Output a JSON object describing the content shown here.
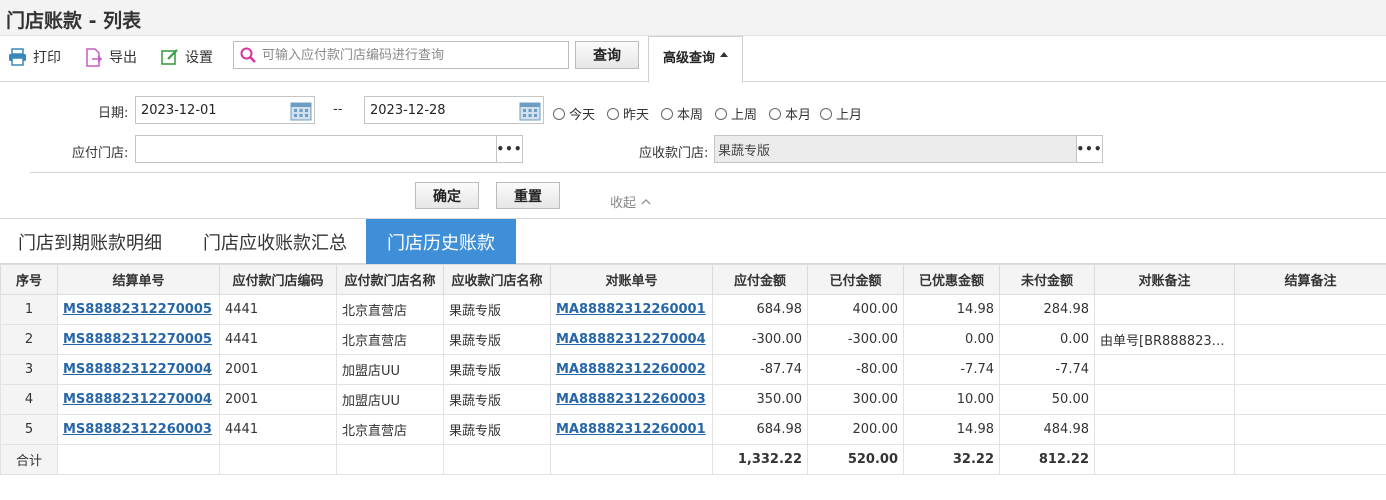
{
  "page": {
    "title": "门店账款 - 列表"
  },
  "toolbar": {
    "print_label": "打印",
    "export_label": "导出",
    "settings_label": "设置",
    "search_placeholder": "可输入应付款门店编码进行查询",
    "search_value": "",
    "query_label": "查询",
    "advanced_label": "高级查询"
  },
  "filter": {
    "date_label": "日期:",
    "date_from": "2023-12-01",
    "date_sep": "--",
    "date_to": "2023-12-28",
    "quick_ranges": [
      "今天",
      "昨天",
      "本周",
      "上周",
      "本月",
      "上月"
    ],
    "payer_label": "应付门店:",
    "payer_value": "",
    "payee_label": "应收款门店:",
    "payee_value": "果蔬专版",
    "confirm_label": "确定",
    "reset_label": "重置",
    "collapse_label": "收起"
  },
  "tabs": [
    {
      "label": "门店到期账款明细",
      "active": false
    },
    {
      "label": "门店应收账款汇总",
      "active": false
    },
    {
      "label": "门店历史账款",
      "active": true
    }
  ],
  "table": {
    "headers": [
      "序号",
      "结算单号",
      "应付款门店编码",
      "应付款门店名称",
      "应收款门店名称",
      "对账单号",
      "应付金额",
      "已付金额",
      "已优惠金额",
      "未付金额",
      "对账备注",
      "结算备注"
    ],
    "rows": [
      [
        "1",
        "MS88882312270005",
        "4441",
        "北京直营店",
        "果蔬专版",
        "MA88882312260001",
        "684.98",
        "400.00",
        "14.98",
        "284.98",
        "",
        ""
      ],
      [
        "2",
        "MS88882312270005",
        "4441",
        "北京直营店",
        "果蔬专版",
        "MA88882312270004",
        "-300.00",
        "-300.00",
        "0.00",
        "0.00",
        "由单号[BR8888231...",
        ""
      ],
      [
        "3",
        "MS88882312270004",
        "2001",
        "加盟店UU",
        "果蔬专版",
        "MA88882312260002",
        "-87.74",
        "-80.00",
        "-7.74",
        "-7.74",
        "",
        ""
      ],
      [
        "4",
        "MS88882312270004",
        "2001",
        "加盟店UU",
        "果蔬专版",
        "MA88882312260003",
        "350.00",
        "300.00",
        "10.00",
        "50.00",
        "",
        ""
      ],
      [
        "5",
        "MS88882312260003",
        "4441",
        "北京直营店",
        "果蔬专版",
        "MA88882312260001",
        "684.98",
        "200.00",
        "14.98",
        "484.98",
        "",
        ""
      ]
    ],
    "total": [
      "合计",
      "",
      "",
      "",
      "",
      "",
      "1,332.22",
      "520.00",
      "32.22",
      "812.22",
      "",
      ""
    ]
  },
  "colors": {
    "accent": "#3e8ed8",
    "link": "#2666a8"
  }
}
